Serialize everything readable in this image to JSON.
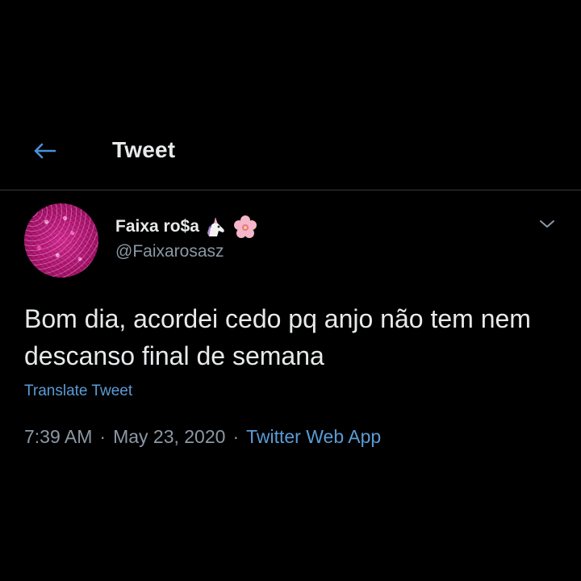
{
  "header": {
    "back_icon": "arrow-left-icon",
    "title": "Tweet"
  },
  "tweet": {
    "author": {
      "display_name": "Faixa ro$a",
      "name_emojis": [
        "unicorn-icon",
        "cherry-blossom-icon"
      ],
      "handle": "@Faixarosasz"
    },
    "more_icon": "chevron-down-icon",
    "text": "Bom dia, acordei cedo pq anjo não tem nem descanso final de semana",
    "translate_label": "Translate Tweet",
    "time": "7:39 AM",
    "separator": "·",
    "date": "May 23, 2020",
    "source": "Twitter Web App"
  },
  "colors": {
    "background": "#000000",
    "text": "#e7e9ea",
    "secondary_text": "#8b98a5",
    "link": "#5b9bd5",
    "accent_icon": "#4a90d9",
    "divider": "#3b3b3b"
  }
}
